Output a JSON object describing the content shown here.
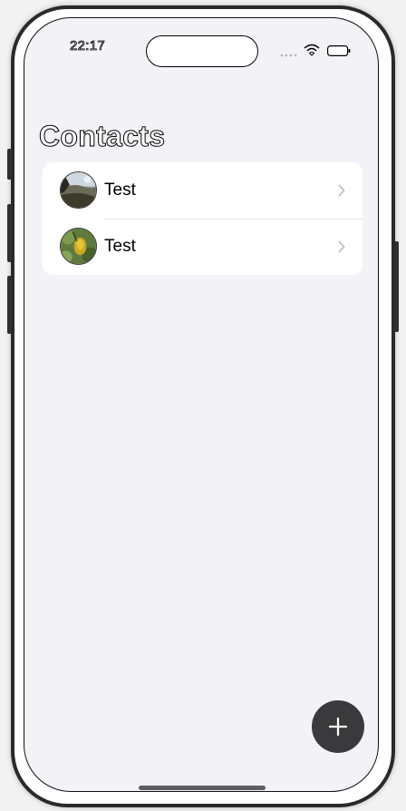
{
  "status_bar": {
    "time": "22:17"
  },
  "navigation": {
    "title": "Contacts"
  },
  "contacts": [
    {
      "name": "Test",
      "avatar": "landscape-photo"
    },
    {
      "name": "Test",
      "avatar": "yellow-flower-photo"
    }
  ],
  "icons": {
    "row_disclosure": "chevron-right-icon",
    "add_button": "plus-icon"
  },
  "colors": {
    "background": "#f2f2f7",
    "card": "#ffffff",
    "fab": "#3a3a3c",
    "separator": "#e3e3e8",
    "chevron": "#c4c4c7"
  }
}
